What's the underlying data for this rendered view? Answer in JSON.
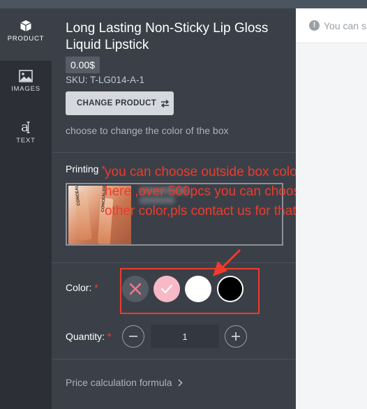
{
  "nav": {
    "items": [
      {
        "label": "PRODUCT",
        "icon": "box-icon"
      },
      {
        "label": "IMAGES",
        "icon": "image-icon"
      },
      {
        "label": "TEXT",
        "icon": "text-icon"
      }
    ]
  },
  "product": {
    "title": "Long Lasting Non-Sticky Lip Gloss Liquid Lipstick",
    "price": "0.00$",
    "sku": "SKU: T-LG014-A-1",
    "change_button": "CHANGE PRODUCT",
    "hint": "choose to change the color of the box"
  },
  "printing": {
    "label": "Printing",
    "required_mark": "*",
    "thumb_text": "CONCEALER"
  },
  "annotation": {
    "text": "you can choose outside box color here ,over 500pcs you can choose other color,pls contact us for that",
    "color": "#ee3b2d"
  },
  "color": {
    "label": "Color:",
    "required_mark": "*",
    "options": [
      {
        "name": "none",
        "hex": "#555b64"
      },
      {
        "name": "pink",
        "hex": "#f7b9c6",
        "selected": true
      },
      {
        "name": "white",
        "hex": "#ffffff"
      },
      {
        "name": "black",
        "hex": "#000000"
      }
    ]
  },
  "quantity": {
    "label": "Quantity:",
    "required_mark": "*",
    "value": "1",
    "minus": "−",
    "plus": "+"
  },
  "formula": {
    "label": "Price calculation formula"
  },
  "notice": {
    "text": "You can s"
  },
  "colors": {
    "panel": "#3b4048",
    "nav": "#2c3036",
    "accent_required": "#e0473b"
  }
}
